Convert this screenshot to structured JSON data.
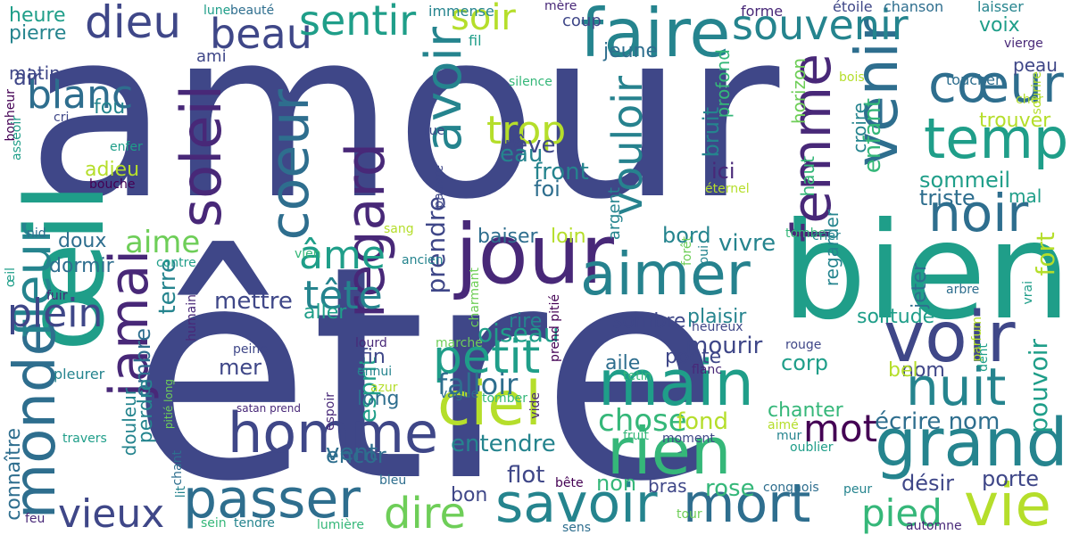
{
  "palette": [
    "#3f4788",
    "#2e6e8e",
    "#25848e",
    "#1f9e89",
    "#35b779",
    "#6ece58",
    "#b5de2b",
    "#440154",
    "#482878",
    "#26828e"
  ],
  "words": [
    {
      "text": "amour"
    },
    {
      "text": "être"
    },
    {
      "text": "bien"
    },
    {
      "text": "jour"
    },
    {
      "text": "aimer"
    },
    {
      "text": "faire"
    },
    {
      "text": "œil"
    },
    {
      "text": "voir"
    },
    {
      "text": "grand"
    },
    {
      "text": "nuit"
    },
    {
      "text": "homme"
    },
    {
      "text": "ciel"
    },
    {
      "text": "main"
    },
    {
      "text": "rien"
    },
    {
      "text": "savoir"
    },
    {
      "text": "mort"
    },
    {
      "text": "passer"
    },
    {
      "text": "vie"
    },
    {
      "text": "temp"
    },
    {
      "text": "cœur"
    },
    {
      "text": "noir"
    },
    {
      "text": "venir"
    },
    {
      "text": "femme"
    },
    {
      "text": "vouloir"
    },
    {
      "text": "soleil"
    },
    {
      "text": "coeur"
    },
    {
      "text": "regard"
    },
    {
      "text": "avoir"
    },
    {
      "text": "petit"
    },
    {
      "text": "monde"
    },
    {
      "text": "jamai"
    },
    {
      "text": "fleur"
    },
    {
      "text": "dieu"
    },
    {
      "text": "beau"
    },
    {
      "text": "sentir"
    },
    {
      "text": "soir"
    },
    {
      "text": "souvenir"
    },
    {
      "text": "blanc"
    },
    {
      "text": "trop"
    },
    {
      "text": "âme"
    },
    {
      "text": "tête"
    },
    {
      "text": "dire"
    },
    {
      "text": "vieux"
    },
    {
      "text": "plein"
    },
    {
      "text": "aime"
    },
    {
      "text": "mot"
    },
    {
      "text": "pied"
    },
    {
      "text": "chose"
    },
    {
      "text": "falloir"
    },
    {
      "text": "oiseau"
    },
    {
      "text": "mourir"
    },
    {
      "text": "vivre"
    },
    {
      "text": "mettre"
    },
    {
      "text": "terre"
    },
    {
      "text": "esprit"
    },
    {
      "text": "écrire nom"
    },
    {
      "text": "pouvoir"
    },
    {
      "text": "entendre"
    },
    {
      "text": "fond"
    },
    {
      "text": "corp"
    },
    {
      "text": "rose"
    },
    {
      "text": "flot"
    },
    {
      "text": "vent"
    },
    {
      "text": "non"
    },
    {
      "text": "bras"
    },
    {
      "text": "désir"
    },
    {
      "text": "porte"
    },
    {
      "text": "prendre"
    },
    {
      "text": "rêve"
    },
    {
      "text": "eau"
    },
    {
      "text": "front"
    },
    {
      "text": "foi"
    },
    {
      "text": "bruit"
    },
    {
      "text": "ici"
    },
    {
      "text": "sommeil"
    },
    {
      "text": "triste"
    },
    {
      "text": "enfant"
    },
    {
      "text": "fort"
    },
    {
      "text": "dormir"
    },
    {
      "text": "doux"
    },
    {
      "text": "mer"
    },
    {
      "text": "fou"
    },
    {
      "text": "adieu"
    },
    {
      "text": "air"
    },
    {
      "text": "heure"
    },
    {
      "text": "pierre"
    },
    {
      "text": "matin"
    },
    {
      "text": "ami"
    },
    {
      "text": "ombre"
    },
    {
      "text": "perdre"
    },
    {
      "text": "douleur"
    },
    {
      "text": "connaître"
    },
    {
      "text": "loin"
    },
    {
      "text": "baiser"
    },
    {
      "text": "bord"
    },
    {
      "text": "sombre"
    },
    {
      "text": "aile"
    },
    {
      "text": "poète"
    },
    {
      "text": "rire"
    },
    {
      "text": "fin"
    },
    {
      "text": "long"
    },
    {
      "text": "aller"
    },
    {
      "text": "encor"
    },
    {
      "text": "bon"
    },
    {
      "text": "jeune"
    },
    {
      "text": "coup"
    },
    {
      "text": "voix"
    },
    {
      "text": "peau"
    },
    {
      "text": "mal"
    },
    {
      "text": "solitude"
    },
    {
      "text": "nom"
    },
    {
      "text": "bel"
    },
    {
      "text": "chanter"
    },
    {
      "text": "plaisir"
    },
    {
      "text": "regarder"
    },
    {
      "text": "jeter"
    },
    {
      "text": "croire"
    },
    {
      "text": "haut"
    },
    {
      "text": "horizon"
    },
    {
      "text": "profond"
    },
    {
      "text": "argent"
    },
    {
      "text": "trouver"
    },
    {
      "text": "forme"
    },
    {
      "text": "lune"
    },
    {
      "text": "beauté"
    },
    {
      "text": "immense"
    },
    {
      "text": "mère"
    },
    {
      "text": "étoile"
    },
    {
      "text": "chanson"
    },
    {
      "text": "laisser"
    },
    {
      "text": "fil"
    },
    {
      "text": "vierge"
    },
    {
      "text": "silence"
    },
    {
      "text": "bois"
    },
    {
      "text": "toucher"
    },
    {
      "text": "cher"
    },
    {
      "text": "sourire"
    },
    {
      "text": "bonheur"
    },
    {
      "text": "asseoir"
    },
    {
      "text": "cri"
    },
    {
      "text": "enfer"
    },
    {
      "text": "bouche"
    },
    {
      "text": "rue"
    },
    {
      "text": "pauvre"
    },
    {
      "text": "éternel"
    },
    {
      "text": "nid"
    },
    {
      "text": "sang"
    },
    {
      "text": "tombe"
    },
    {
      "text": "crier"
    },
    {
      "text": "forêt"
    },
    {
      "text": "oui"
    },
    {
      "text": "contre"
    },
    {
      "text": "vien"
    },
    {
      "text": "ancien"
    },
    {
      "text": "œil"
    },
    {
      "text": "fuir"
    },
    {
      "text": "humain"
    },
    {
      "text": "charmant"
    },
    {
      "text": "prend pitié"
    },
    {
      "text": "arbre"
    },
    {
      "text": "vrai"
    },
    {
      "text": "lourd"
    },
    {
      "text": "heureux"
    },
    {
      "text": "parfum"
    },
    {
      "text": "peine"
    },
    {
      "text": "marche"
    },
    {
      "text": "rouge"
    },
    {
      "text": "dent"
    },
    {
      "text": "pleurer"
    },
    {
      "text": "ennui"
    },
    {
      "text": "tetin"
    },
    {
      "text": "flanc"
    },
    {
      "text": "espoir"
    },
    {
      "text": "azur"
    },
    {
      "text": "vague"
    },
    {
      "text": "tomber"
    },
    {
      "text": "vide"
    },
    {
      "text": "pitié long"
    },
    {
      "text": "satan prend"
    },
    {
      "text": "fruit"
    },
    {
      "text": "moment"
    },
    {
      "text": "aimé"
    },
    {
      "text": "mur"
    },
    {
      "text": "oublier"
    },
    {
      "text": "travers"
    },
    {
      "text": "chant"
    },
    {
      "text": "lit"
    },
    {
      "text": "bleu"
    },
    {
      "text": "bête"
    },
    {
      "text": "congnois"
    },
    {
      "text": "peur"
    },
    {
      "text": "feu"
    },
    {
      "text": "sein"
    },
    {
      "text": "tendre"
    },
    {
      "text": "lumière"
    },
    {
      "text": "sens"
    },
    {
      "text": "tour"
    },
    {
      "text": "automne"
    }
  ]
}
